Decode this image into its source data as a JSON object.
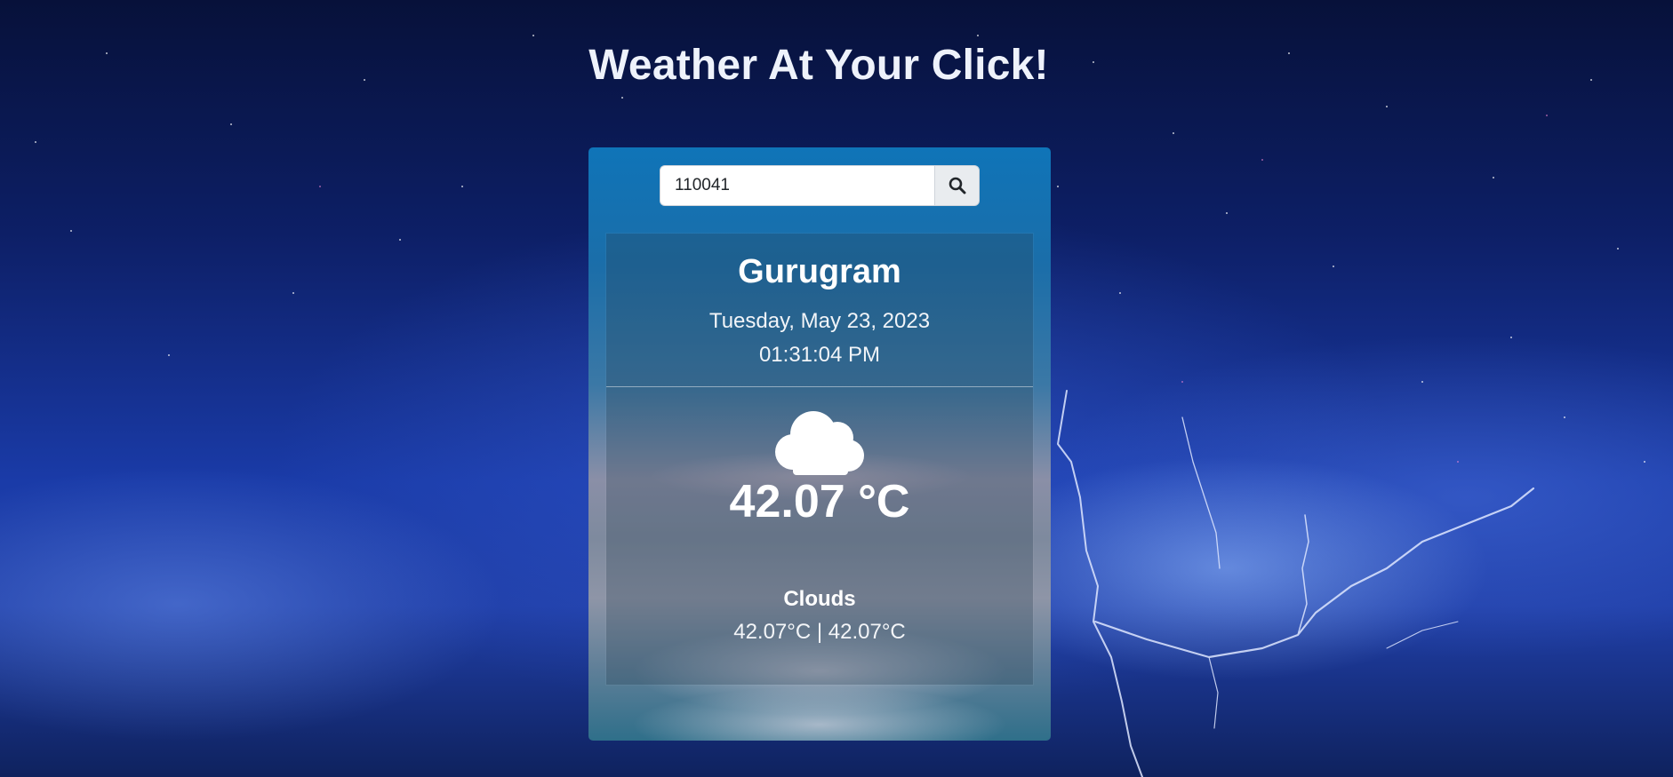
{
  "page": {
    "title": "Weather At Your Click!"
  },
  "search": {
    "value": "110041",
    "button_icon": "search-icon"
  },
  "weather": {
    "city": "Gurugram",
    "date": "Tuesday, May 23, 2023",
    "time": "01:31:04 PM",
    "icon": "cloud-icon",
    "temperature": "42.07 °C",
    "condition": "Clouds",
    "min_max": "42.07°C | 42.07°C"
  },
  "colors": {
    "title_text": "#eef2fb",
    "card_top": "#0f74b8",
    "background_dark": "#07113a",
    "background_mid": "#1a3ba8"
  }
}
